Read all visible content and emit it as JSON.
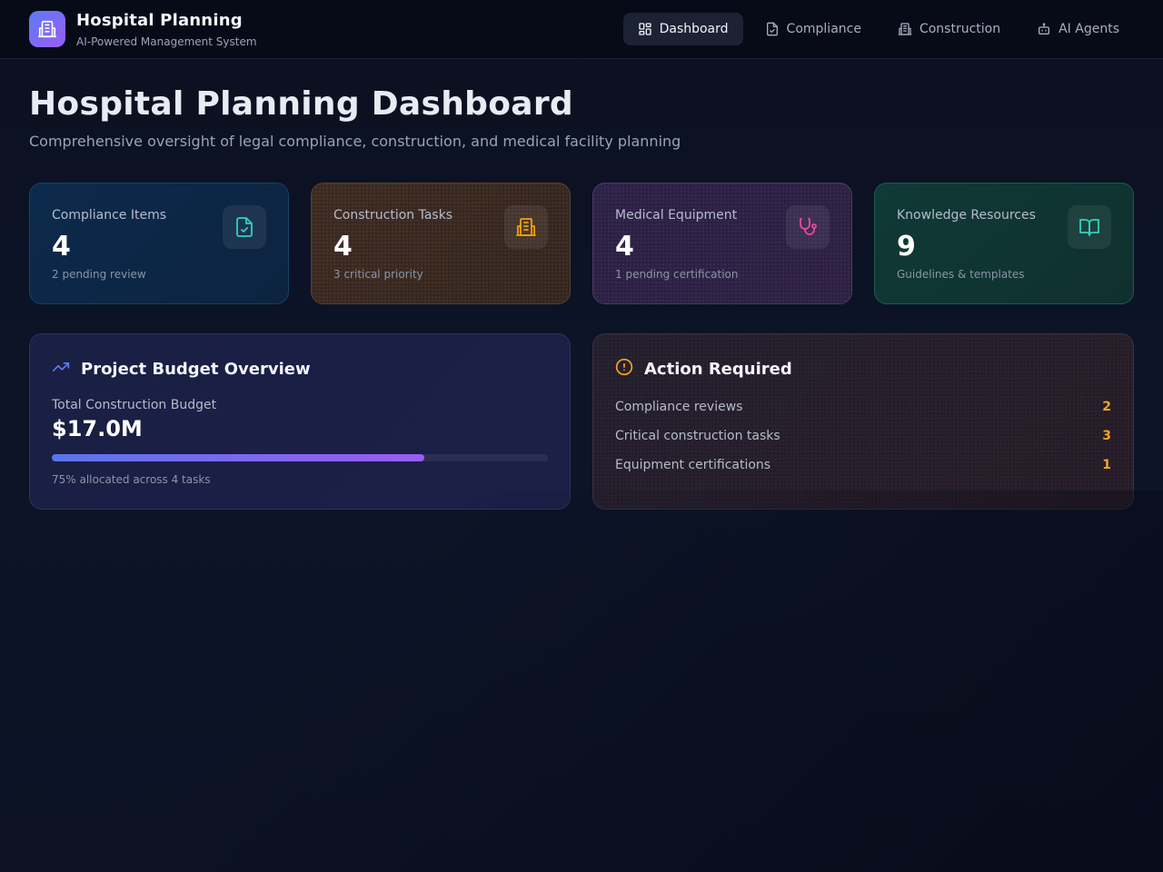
{
  "brand": {
    "title": "Hospital Planning",
    "subtitle": "AI-Powered Management System"
  },
  "nav": {
    "items": [
      {
        "label": "Dashboard",
        "icon": "dashboard-icon",
        "active": true
      },
      {
        "label": "Compliance",
        "icon": "file-check-icon",
        "active": false
      },
      {
        "label": "Construction",
        "icon": "building-icon",
        "active": false
      },
      {
        "label": "AI Agents",
        "icon": "bot-icon",
        "active": false
      }
    ]
  },
  "page": {
    "title": "Hospital Planning Dashboard",
    "subtitle": "Comprehensive oversight of legal compliance, construction, and medical facility planning"
  },
  "stats": [
    {
      "label": "Compliance Items",
      "value": "4",
      "note": "2 pending review",
      "icon": "file-check-icon",
      "accent": "#2dd4bf"
    },
    {
      "label": "Construction Tasks",
      "value": "4",
      "note": "3 critical priority",
      "icon": "building-icon",
      "accent": "#f59e0b"
    },
    {
      "label": "Medical Equipment",
      "value": "4",
      "note": "1 pending certification",
      "icon": "stethoscope-icon",
      "accent": "#ec4899"
    },
    {
      "label": "Knowledge Resources",
      "value": "9",
      "note": "Guidelines & templates",
      "icon": "book-open-icon",
      "accent": "#2dd4bf"
    }
  ],
  "budget": {
    "title": "Project Budget Overview",
    "icon": "trending-up-icon",
    "label": "Total Construction Budget",
    "value": "$17.0M",
    "progress_percent": 75,
    "note": "75% allocated across 4 tasks"
  },
  "actions": {
    "title": "Action Required",
    "icon": "alert-circle-icon",
    "items": [
      {
        "label": "Compliance reviews",
        "count": "2"
      },
      {
        "label": "Critical construction tasks",
        "count": "3"
      },
      {
        "label": "Equipment certifications",
        "count": "1"
      }
    ]
  },
  "colors": {
    "accent_gradient_start": "#5b74ee",
    "accent_gradient_end": "#9a5cf4",
    "warning": "#f5a524"
  }
}
